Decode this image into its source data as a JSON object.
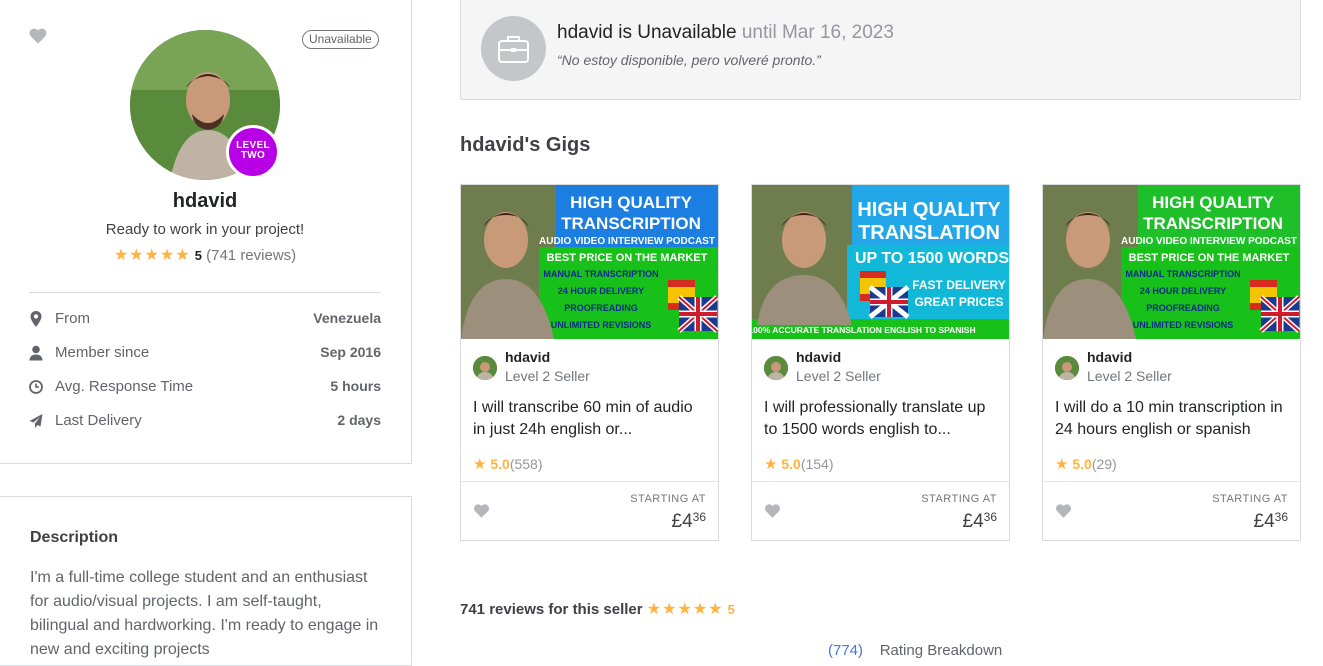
{
  "profile": {
    "status_badge": "Unavailable",
    "level_badge_line1": "LEVEL",
    "level_badge_line2": "TWO",
    "username": "hdavid",
    "tagline": "Ready to work in your project!",
    "stars": "★★★★★",
    "rating": "5",
    "reviews_count": "(741 reviews)",
    "stats": [
      {
        "label": "From",
        "value": "Venezuela",
        "icon": "location-pin-icon"
      },
      {
        "label": "Member since",
        "value": "Sep 2016",
        "icon": "user-icon"
      },
      {
        "label": "Avg. Response Time",
        "value": "5 hours",
        "icon": "clock-icon"
      },
      {
        "label": "Last Delivery",
        "value": "2 days",
        "icon": "paper-plane-icon"
      }
    ]
  },
  "description": {
    "title": "Description",
    "text": "I'm a full-time college student and an enthusiast for audio/visual projects. I am self-taught, bilingual and hardworking. I'm ready to engage in new and exciting projects"
  },
  "banner": {
    "title": "hdavid is Unavailable",
    "until": "until Mar 16, 2023",
    "message": "“No estoy disponible, pero volveré pronto.”"
  },
  "gigs_heading": "hdavid's Gigs",
  "gigs": [
    {
      "img_lines": [
        "HIGH QUALITY",
        "TRANSCRIPTION",
        "AUDIO VIDEO INTERVIEW PODCAST",
        "BEST PRICE ON THE MARKET",
        "MANUAL TRANSCRIPTION",
        "24 HOUR DELIVERY",
        "PROOFREADING",
        "UNLIMITED REVISIONS"
      ],
      "seller": "hdavid",
      "level": "Level 2 Seller",
      "title": "I will transcribe 60 min of audio in just 24h english or...",
      "rating": "5.0",
      "count": "(558)",
      "starting_label": "STARTING AT",
      "price": "£4",
      "price_cents": "36"
    },
    {
      "img_lines": [
        "HIGH QUALITY",
        "TRANSLATION",
        "UP TO 1500 WORDS",
        "FAST DELIVERY",
        "GREAT PRICES",
        "100% ACCURATE TRANSLATION ENGLISH TO SPANISH"
      ],
      "seller": "hdavid",
      "level": "Level 2 Seller",
      "title": "I will professionally translate up to 1500 words english to...",
      "rating": "5.0",
      "count": "(154)",
      "starting_label": "STARTING AT",
      "price": "£4",
      "price_cents": "36"
    },
    {
      "img_lines": [
        "HIGH QUALITY",
        "TRANSCRIPTION",
        "AUDIO VIDEO INTERVIEW PODCAST",
        "BEST PRICE ON THE MARKET",
        "MANUAL TRANSCRIPTION",
        "24 HOUR DELIVERY",
        "PROOFREADING",
        "UNLIMITED REVISIONS"
      ],
      "seller": "hdavid",
      "level": "Level 2 Seller",
      "title": "I will do a 10 min transcription in 24 hours english or spanish",
      "rating": "5.0",
      "count": "(29)",
      "starting_label": "STARTING AT",
      "price": "£4",
      "price_cents": "36"
    }
  ],
  "reviews_summary": {
    "text": "741 reviews for this seller",
    "stars": "★★★★★",
    "score": "5"
  },
  "peek": {
    "count": "(774)",
    "label": "Rating Breakdown"
  },
  "colors": {
    "accent_star": "#ffb33e",
    "level_badge": "#b800e6",
    "green_banner": "#1dbf73"
  }
}
